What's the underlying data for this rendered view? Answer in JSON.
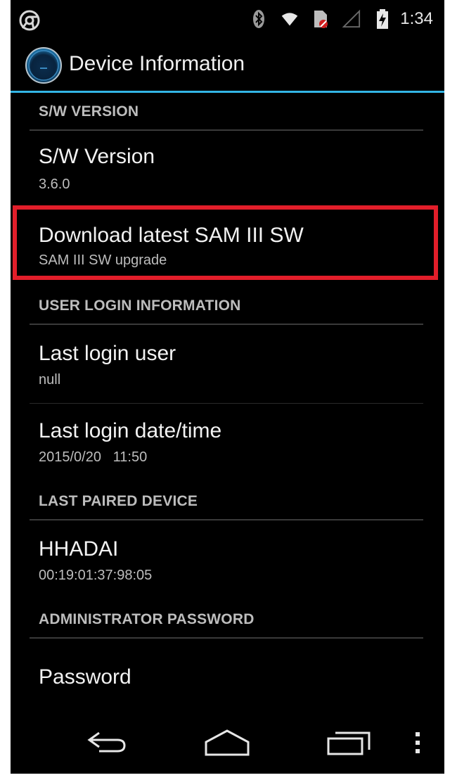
{
  "status_bar": {
    "time": "1:34",
    "icons": [
      "chrome-icon",
      "bluetooth-icon",
      "wifi-icon",
      "sim-icon",
      "signal-icon",
      "battery-charging-icon"
    ]
  },
  "action_bar": {
    "title": "Device Information"
  },
  "sections": [
    {
      "header": "S/W VERSION"
    },
    {
      "header": "USER LOGIN INFORMATION"
    },
    {
      "header": "LAST PAIRED DEVICE"
    },
    {
      "header": "ADMINISTRATOR PASSWORD"
    }
  ],
  "items": {
    "sw_version": {
      "title": "S/W Version",
      "summary": "3.6.0"
    },
    "download": {
      "title": "Download latest SAM III SW",
      "summary": "SAM III SW upgrade"
    },
    "last_login_user": {
      "title": "Last login user",
      "summary": "null"
    },
    "last_login_datetime": {
      "title": "Last login date/time",
      "summary": "2015/0/20   11:50"
    },
    "paired_device": {
      "title": "HHADAI",
      "summary": "00:19:01:37:98:05"
    },
    "password": {
      "title": "Password"
    }
  },
  "colors": {
    "accent": "#33b5e5",
    "highlight": "#e21e2a",
    "background": "#000000"
  }
}
